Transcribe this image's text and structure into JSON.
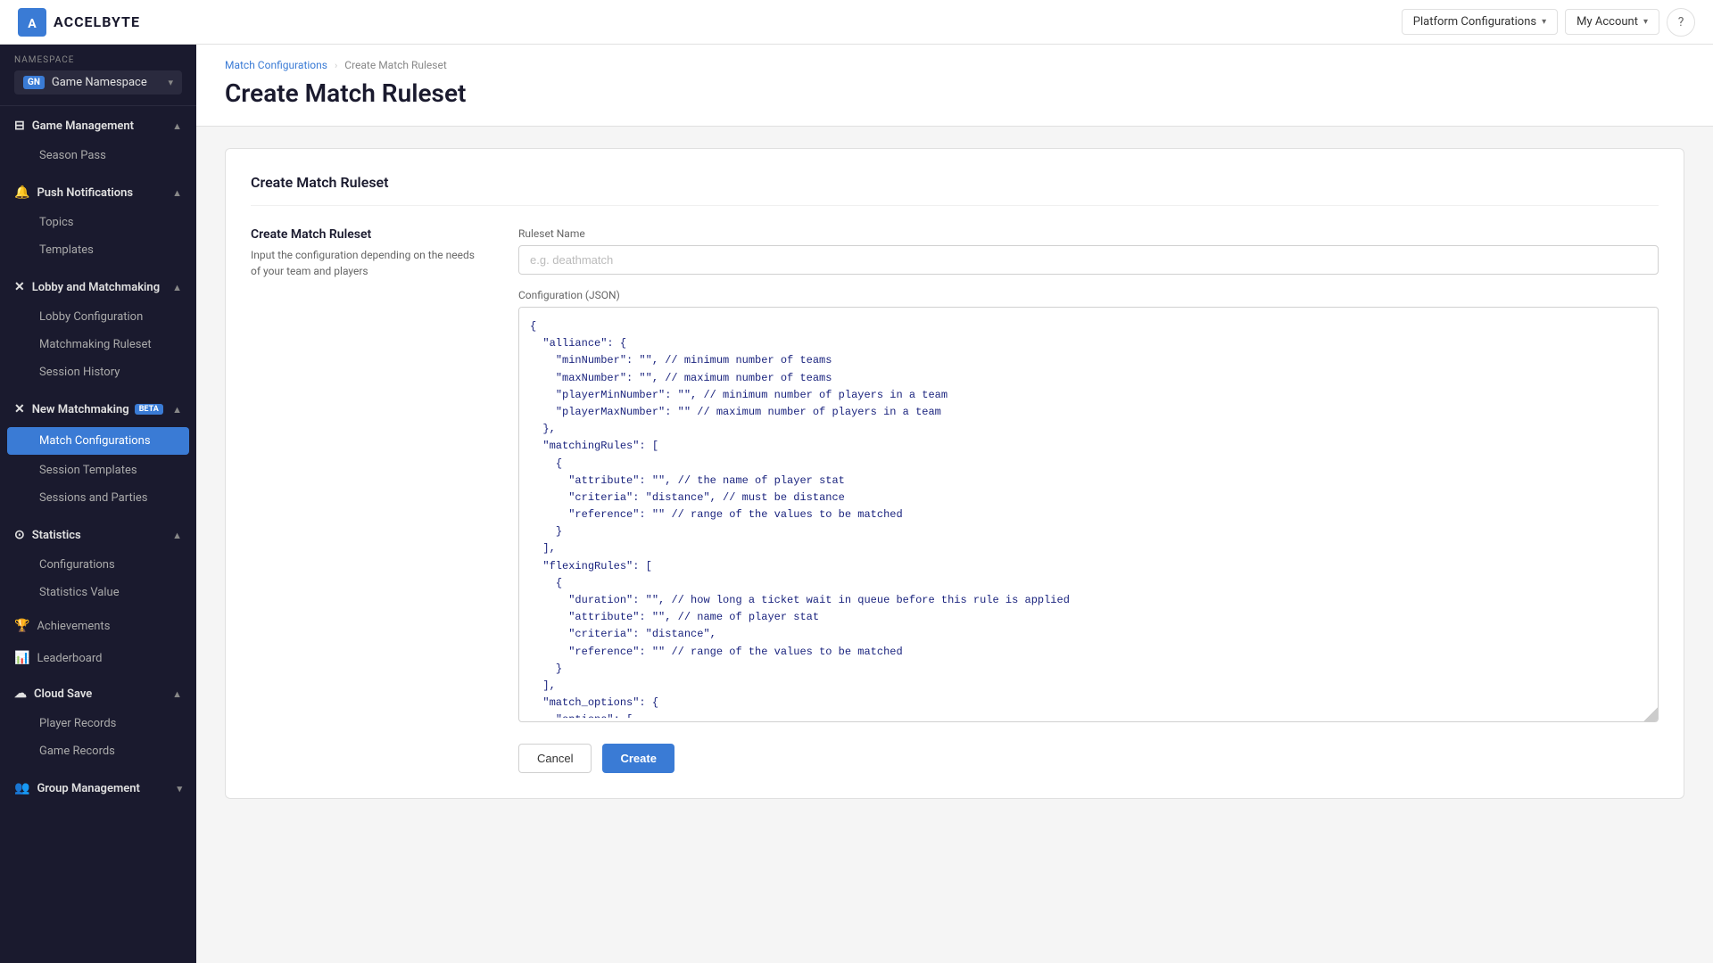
{
  "header": {
    "logo_text": "ACCELBYTE",
    "platform_configurations_label": "Platform Configurations",
    "my_account_label": "My Account",
    "help_icon": "?"
  },
  "sidebar": {
    "namespace_label": "NAMESPACE",
    "namespace_badge": "GN",
    "namespace_name": "Game Namespace",
    "sections": [
      {
        "id": "game-management",
        "title": "Game Management",
        "icon": "−",
        "collapsed": false,
        "items": [
          {
            "id": "season-pass",
            "label": "Season Pass",
            "active": false
          }
        ]
      },
      {
        "id": "push-notifications",
        "title": "Push Notifications",
        "icon": "🔔",
        "collapsed": false,
        "items": [
          {
            "id": "topics",
            "label": "Topics",
            "active": false
          },
          {
            "id": "templates",
            "label": "Templates",
            "active": false
          }
        ]
      },
      {
        "id": "lobby-matchmaking",
        "title": "Lobby and Matchmaking",
        "icon": "✕",
        "collapsed": false,
        "items": [
          {
            "id": "lobby-configuration",
            "label": "Lobby Configuration",
            "active": false
          },
          {
            "id": "matchmaking-ruleset",
            "label": "Matchmaking Ruleset",
            "active": false
          },
          {
            "id": "session-history",
            "label": "Session History",
            "active": false
          }
        ]
      },
      {
        "id": "new-matchmaking",
        "title": "New Matchmaking",
        "beta": true,
        "icon": "✕",
        "collapsed": false,
        "items": [
          {
            "id": "match-configurations",
            "label": "Match Configurations",
            "active": true
          },
          {
            "id": "session-templates",
            "label": "Session Templates",
            "active": false
          },
          {
            "id": "sessions-parties",
            "label": "Sessions and Parties",
            "active": false
          }
        ]
      },
      {
        "id": "statistics",
        "title": "Statistics",
        "icon": "⊙",
        "collapsed": false,
        "items": [
          {
            "id": "configurations",
            "label": "Configurations",
            "active": false
          },
          {
            "id": "statistics-value",
            "label": "Statistics Value",
            "active": false
          }
        ]
      },
      {
        "id": "achievements",
        "title": "Achievements",
        "icon": "🏆",
        "single": true,
        "active": false
      },
      {
        "id": "leaderboard",
        "title": "Leaderboard",
        "icon": "📊",
        "single": true,
        "active": false
      },
      {
        "id": "cloud-save",
        "title": "Cloud Save",
        "icon": "☁",
        "collapsed": false,
        "items": [
          {
            "id": "player-records",
            "label": "Player Records",
            "active": false
          },
          {
            "id": "game-records",
            "label": "Game Records",
            "active": false
          }
        ]
      },
      {
        "id": "group-management",
        "title": "Group Management",
        "icon": "👥",
        "collapsed": false,
        "items": []
      }
    ]
  },
  "breadcrumb": {
    "parent_label": "Match Configurations",
    "separator": ">",
    "current_label": "Create Match Ruleset"
  },
  "page": {
    "title": "Create Match Ruleset"
  },
  "card": {
    "title": "Create Match Ruleset",
    "form_section_title": "Create Match Ruleset",
    "form_section_desc": "Input the configuration depending on the needs of your team and players",
    "ruleset_name_label": "Ruleset Name",
    "ruleset_name_placeholder": "e.g. deathmatch",
    "config_json_label": "Configuration (JSON)",
    "json_content": "{\n  \"alliance\": {\n    \"minNumber\": \"\", // minimum number of teams\n    \"maxNumber\": \"\", // maximum number of teams\n    \"playerMinNumber\": \"\", // minimum number of players in a team\n    \"playerMaxNumber\": \"\" // maximum number of players in a team\n  },\n  \"matchingRules\": [\n    {\n      \"attribute\": \"\", // the name of player stat\n      \"criteria\": \"distance\", // must be distance\n      \"reference\": \"\" // range of the values to be matched\n    }\n  ],\n  \"flexingRules\": [\n    {\n      \"duration\": \"\", // how long a ticket wait in queue before this rule is applied\n      \"attribute\": \"\", // name of player stat\n      \"criteria\": \"distance\",\n      \"reference\": \"\" // range of the values to be matched\n    }\n  ],\n  \"match_options\": {\n    \"options\": [\n      {\n        \"name\": \"\", // option name in ticket attributes to be matched\n        \"type\": \"\" // \"any\", \"all\" or \"unique\"",
    "cancel_label": "Cancel",
    "create_label": "Create"
  }
}
